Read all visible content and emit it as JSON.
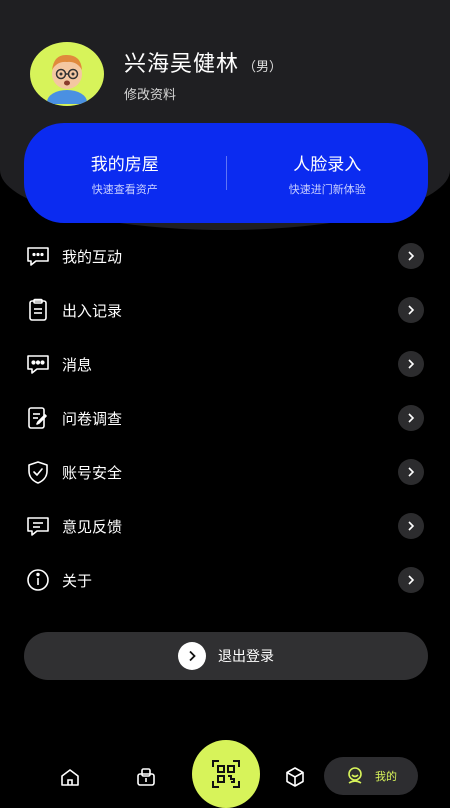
{
  "profile": {
    "name": "兴海吴健林",
    "gender": "（男）",
    "edit_label": "修改资料"
  },
  "cards": [
    {
      "title": "我的房屋",
      "subtitle": "快速查看资产"
    },
    {
      "title": "人脸录入",
      "subtitle": "快速进门新体验"
    }
  ],
  "menu": [
    {
      "label": "我的互动",
      "icon": "chat-icon"
    },
    {
      "label": "出入记录",
      "icon": "clipboard-icon"
    },
    {
      "label": "消息",
      "icon": "message-icon"
    },
    {
      "label": "问卷调查",
      "icon": "survey-icon"
    },
    {
      "label": "账号安全",
      "icon": "shield-icon"
    },
    {
      "label": "意见反馈",
      "icon": "feedback-icon"
    },
    {
      "label": "关于",
      "icon": "info-icon"
    }
  ],
  "logout_label": "退出登录",
  "tabbar": {
    "mine_label": "我的"
  },
  "colors": {
    "accent": "#d7f35a",
    "card": "#0b2bf0",
    "background": "#000000"
  }
}
